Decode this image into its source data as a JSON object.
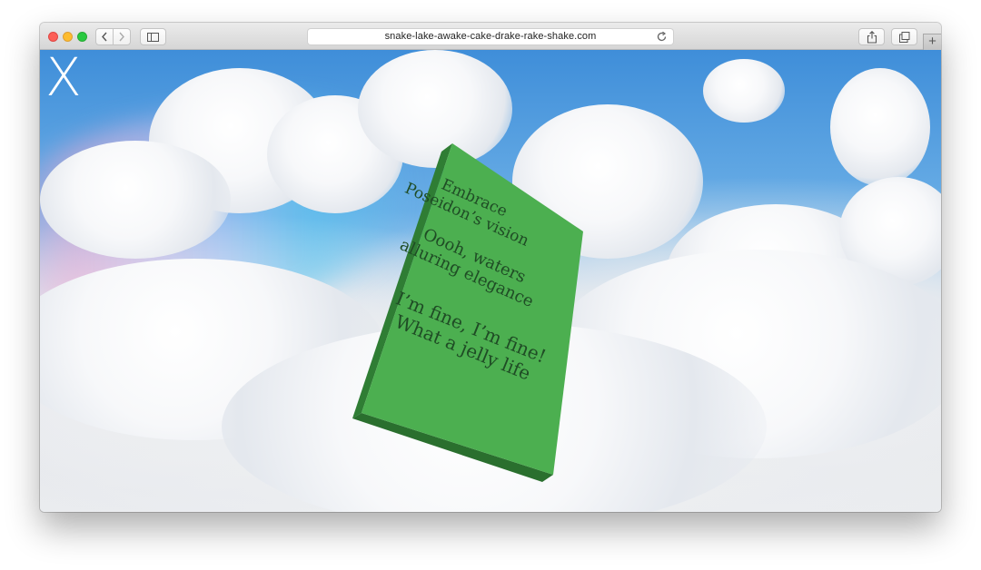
{
  "browser": {
    "url": "snake-lake-awake-cake-drake-rake-shake.com",
    "new_tab_label": "+"
  },
  "page": {
    "close_label": "X",
    "book_lines": [
      "Embrace",
      "Poseidon’s vision",
      "Oooh, waters",
      "alluring elegance",
      "I’m fine, I’m fine!",
      "What a jelly life"
    ],
    "book_color": "#4caf50"
  }
}
